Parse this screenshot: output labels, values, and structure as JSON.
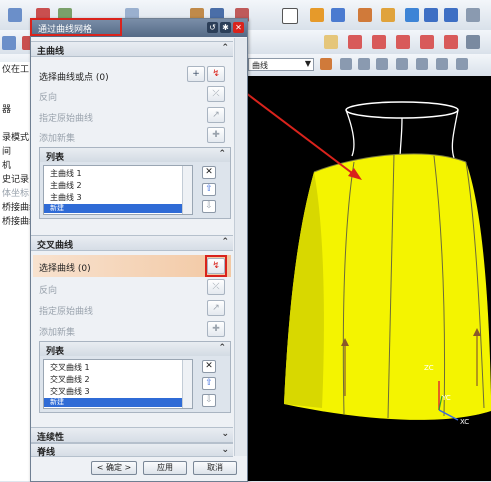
{
  "window": {
    "title": "通过曲线网格"
  },
  "toolbar": {
    "menu_field_value": "曲线",
    "colors": {
      "accent": "#d9231c",
      "yellow": "#f5f500"
    }
  },
  "left_panel": {
    "items": [
      "仪在工",
      "器",
      "录模式",
      "间",
      "机",
      "史记录",
      "体坐标",
      "桥接曲线",
      "桥接曲线"
    ]
  },
  "dialog": {
    "primary": {
      "header": "主曲线",
      "select_label": "选择曲线或点 (0)",
      "reverse": "反向",
      "specify_origin": "指定原始曲线",
      "add_set": "添加新集",
      "list_header": "列表",
      "list_items": [
        "主曲线 1",
        "主曲线 2",
        "主曲线 3"
      ],
      "list_new": "新建"
    },
    "cross": {
      "header": "交叉曲线",
      "select_label": "选择曲线 (0)",
      "reverse": "反向",
      "specify_origin": "指定原始曲线",
      "add_set": "添加新集",
      "list_header": "列表",
      "list_items": [
        "交叉曲线 1",
        "交叉曲线 2",
        "交叉曲线 3"
      ],
      "list_new": "新建"
    },
    "continuity": "连续性",
    "spine": "脊线",
    "buttons": {
      "ok": "< 确定 >",
      "apply": "应用",
      "cancel": "取消"
    }
  },
  "viewport": {
    "axis_zc": "ZC",
    "axis_yc": "YC",
    "axis_xc": "XC"
  }
}
